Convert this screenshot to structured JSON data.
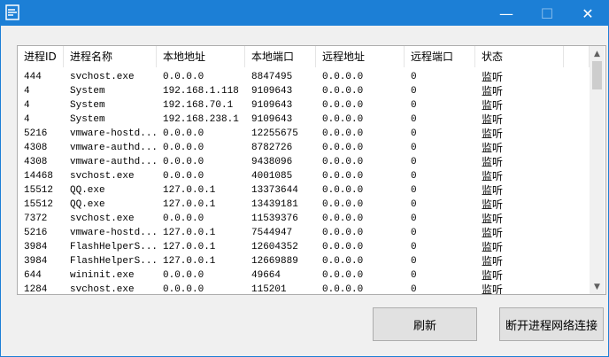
{
  "window": {
    "icon": "app-icon",
    "controls": {
      "minimize": "—",
      "maximize": "☐",
      "close": "✕"
    }
  },
  "table": {
    "columns": [
      "进程ID",
      "进程名称",
      "本地地址",
      "本地端口",
      "远程地址",
      "远程端口",
      "状态"
    ],
    "rows": [
      [
        "444",
        "svchost.exe",
        "0.0.0.0",
        "8847495",
        "0.0.0.0",
        "0",
        "监听"
      ],
      [
        "4",
        "System",
        "192.168.1.118",
        "9109643",
        "0.0.0.0",
        "0",
        "监听"
      ],
      [
        "4",
        "System",
        "192.168.70.1",
        "9109643",
        "0.0.0.0",
        "0",
        "监听"
      ],
      [
        "4",
        "System",
        "192.168.238.1",
        "9109643",
        "0.0.0.0",
        "0",
        "监听"
      ],
      [
        "5216",
        "vmware-hostd...",
        "0.0.0.0",
        "12255675",
        "0.0.0.0",
        "0",
        "监听"
      ],
      [
        "4308",
        "vmware-authd...",
        "0.0.0.0",
        "8782726",
        "0.0.0.0",
        "0",
        "监听"
      ],
      [
        "4308",
        "vmware-authd...",
        "0.0.0.0",
        "9438096",
        "0.0.0.0",
        "0",
        "监听"
      ],
      [
        "14468",
        "svchost.exe",
        "0.0.0.0",
        "4001085",
        "0.0.0.0",
        "0",
        "监听"
      ],
      [
        "15512",
        "QQ.exe",
        "127.0.0.1",
        "13373644",
        "0.0.0.0",
        "0",
        "监听"
      ],
      [
        "15512",
        "QQ.exe",
        "127.0.0.1",
        "13439181",
        "0.0.0.0",
        "0",
        "监听"
      ],
      [
        "7372",
        "svchost.exe",
        "0.0.0.0",
        "11539376",
        "0.0.0.0",
        "0",
        "监听"
      ],
      [
        "5216",
        "vmware-hostd...",
        "127.0.0.1",
        "7544947",
        "0.0.0.0",
        "0",
        "监听"
      ],
      [
        "3984",
        "FlashHelperS...",
        "127.0.0.1",
        "12604352",
        "0.0.0.0",
        "0",
        "监听"
      ],
      [
        "3984",
        "FlashHelperS...",
        "127.0.0.1",
        "12669889",
        "0.0.0.0",
        "0",
        "监听"
      ],
      [
        "644",
        "wininit.exe",
        "0.0.0.0",
        "49664",
        "0.0.0.0",
        "0",
        "监听"
      ],
      [
        "1284",
        "svchost.exe",
        "0.0.0.0",
        "115201",
        "0.0.0.0",
        "0",
        "监听"
      ]
    ]
  },
  "buttons": {
    "refresh": "刷新",
    "disconnect": "断开进程网络连接"
  },
  "colors": {
    "titlebar": "#1c7fd6",
    "button_bg": "#e1e1e1",
    "scroll_thumb": "#cdcdcd"
  }
}
